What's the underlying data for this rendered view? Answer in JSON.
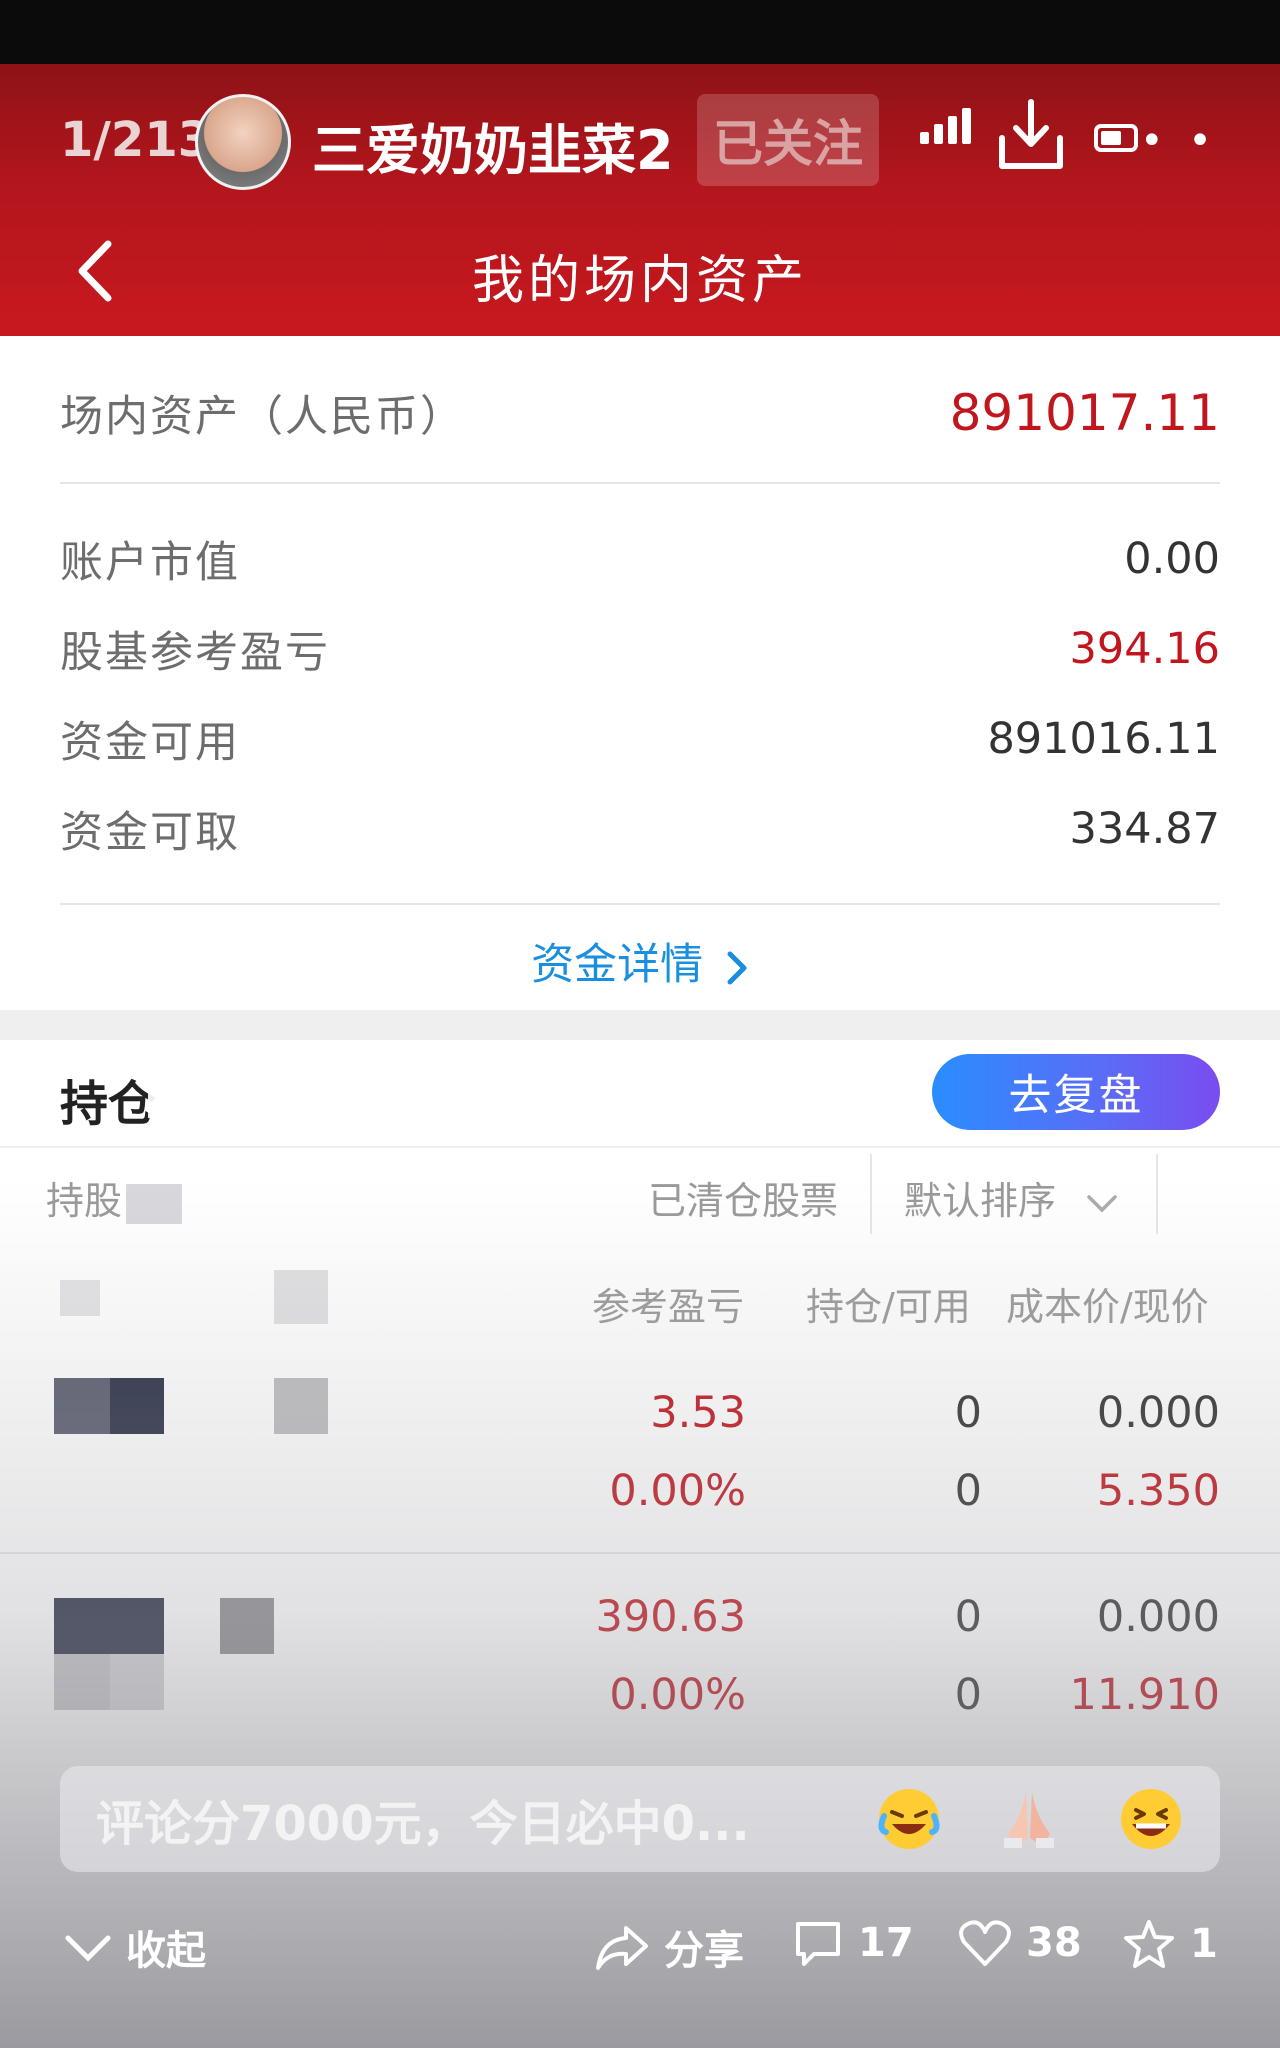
{
  "top": {
    "counter": "1/213",
    "username": "三爱奶奶韭菜2",
    "follow_label": "已关注",
    "more": "• •"
  },
  "header": {
    "title": "我的场内资产"
  },
  "assets": {
    "total_label": "场内资产（人民币）",
    "total_value": "891017.11",
    "items": [
      {
        "label": "账户市值",
        "value": "0.00"
      },
      {
        "label": "股基参考盈亏",
        "value": "394.16"
      },
      {
        "label": "资金可用",
        "value": "891016.11"
      },
      {
        "label": "资金可取",
        "value": "334.87"
      }
    ],
    "fund_detail_link": "资金详情"
  },
  "holdings": {
    "title_visible": "持仓",
    "replay_button": "去复盘",
    "sub_left": "持股",
    "cleared_tab": "已清仓股票",
    "sort_label": "默认排序",
    "columns": {
      "profit": "参考盈亏",
      "position": "持仓/可用",
      "price": "成本价/现价"
    },
    "rows": [
      {
        "profit": "3.53",
        "profit_pct": "0.00%",
        "position": "0",
        "available": "0",
        "cost": "0.000",
        "current": "5.350"
      },
      {
        "profit": "390.63",
        "profit_pct": "0.00%",
        "position": "0",
        "available": "0",
        "cost": "0.000",
        "current": "11.910"
      }
    ]
  },
  "comment": {
    "placeholder": "评论分7000元，今日必中0...",
    "emojis": [
      "laughing-crying-emoji",
      "praying-hands-emoji",
      "grinning-emoji"
    ]
  },
  "bottom": {
    "collapse": "收起",
    "share": "分享",
    "comments": "17",
    "likes": "38",
    "favorites": "1"
  },
  "colors": {
    "header_red": "#c8181f",
    "value_red": "#c1161d",
    "link_blue": "#1b8fdf"
  }
}
